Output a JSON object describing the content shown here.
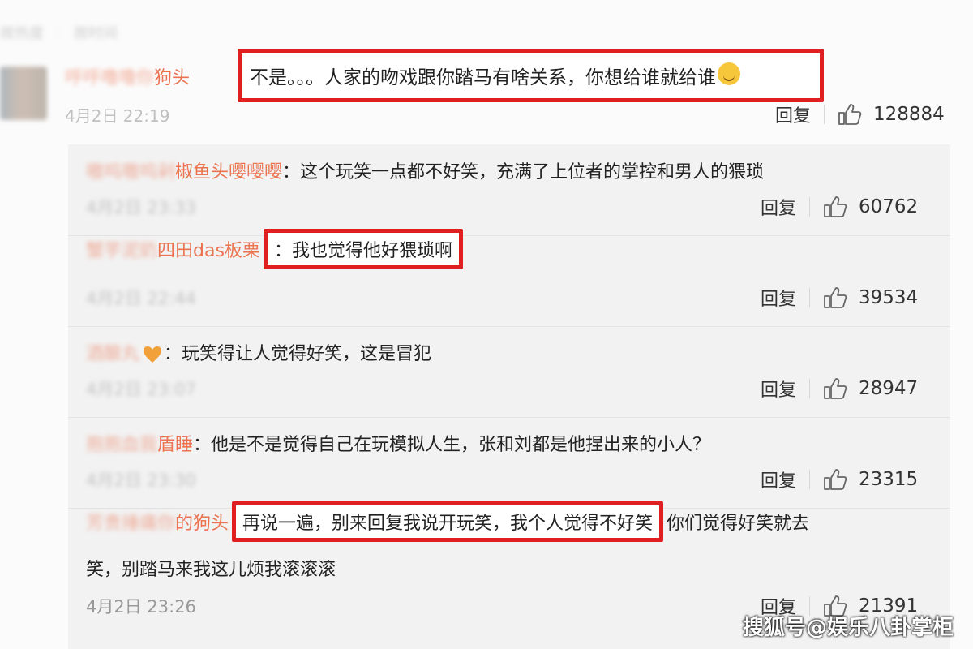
{
  "tabs": [
    "按热度",
    "按时间"
  ],
  "main_comment": {
    "user_tail": "狗头",
    "text": "不是。。。人家的吻戏跟你踏马有啥关系，你想给谁就给谁",
    "time": "4月2日 22:19",
    "reply_label": "回复",
    "likes": "128884"
  },
  "replies": [
    {
      "user_tail": "椒鱼头嘤嘤嘤",
      "text": "：这个玩笑一点都不好笑，充满了上位者的掌控和男人的猥琐",
      "time": "4月2日 23:33",
      "reply_label": "回复",
      "likes": "60762"
    },
    {
      "user_tail": "四田das板栗",
      "text": "：我也觉得他好猥琐啊",
      "time": "4月2日 22:44",
      "reply_label": "回复",
      "likes": "39534"
    },
    {
      "user_tail": "",
      "text": "：玩笑得让人觉得好笑，这是冒犯",
      "time": "4月2日 23:07",
      "reply_label": "回复",
      "likes": "28947"
    },
    {
      "user_tail": "盾睡",
      "text": "：他是不是觉得自己在玩模拟人生，张和刘都是他捏出来的小人？",
      "time": "4月2日 23:30",
      "reply_label": "回复",
      "likes": "23315"
    },
    {
      "user_tail": "的狗头",
      "text_highlight": "再说一遍，别来回复我说开玩笑，我个人觉得不好笑",
      "text_rest": "你们觉得好笑就去",
      "text_line2": "笑，别踏马来我这儿烦我滚滚滚",
      "time": "4月2日 23:26",
      "reply_label": "回复",
      "likes": "21391"
    }
  ],
  "watermark": "搜狐号@娱乐八卦掌柜",
  "colors": {
    "highlight": "#e02020",
    "username": "#eb7350"
  },
  "icons": [
    "thumbs-up-icon",
    "smile-emoji-icon",
    "heart-emoji-icon"
  ]
}
